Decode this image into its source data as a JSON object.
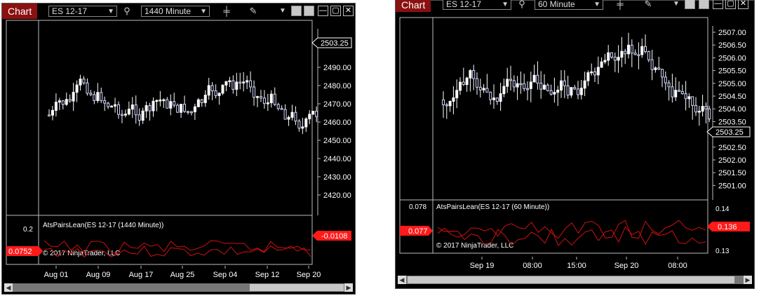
{
  "left": {
    "title": "Chart",
    "instrument": "ES 12-17",
    "interval": "1440 Minute",
    "price_labels": [
      "2490.00",
      "2480.00",
      "2470.00",
      "2460.00",
      "2450.00",
      "2440.00",
      "2430.00",
      "2420.00"
    ],
    "last_price": "2503.25",
    "indicator_label": "AtsPairsLean(ES 12-17 (1440 Minute))",
    "copyright": "© 2017 NinjaTrader, LLC",
    "ind_left_value": "0.2",
    "ind_left_marker": "0.0752",
    "ind_right_marker": "-0.0108",
    "dates": [
      "Aug 01",
      "Aug 09",
      "Aug 17",
      "Aug 25",
      "Sep 04",
      "Sep 12",
      "Sep 20"
    ]
  },
  "right": {
    "title": "Chart",
    "instrument": "ES 12-17",
    "interval": "60 Minute",
    "price_labels": [
      "2507.00",
      "2506.50",
      "2506.00",
      "2505.50",
      "2505.00",
      "2504.50",
      "2504.00",
      "2503.50",
      "2503.00",
      "2502.50",
      "2502.00",
      "2501.50",
      "2501.00"
    ],
    "last_price": "2503.25",
    "indicator_label": "AtsPairsLean(ES 12-17 (60 Minute))",
    "copyright": "© 2017 NinjaTrader, LLC",
    "ind_left_value": "0.078",
    "ind_left_marker": "0.077",
    "ind_right_labels": [
      "0.14",
      "0.13"
    ],
    "ind_right_marker": "0.136",
    "dates": [
      "Sep 19",
      "08:00",
      "15:00",
      "Sep 20",
      "08:00"
    ]
  },
  "colors": {
    "tag": "#8b1010",
    "up": "#ffffff",
    "down": "#d0d8ff",
    "line": "#d01010",
    "marker": "#ff1a1a"
  },
  "icons": [
    "dropdown-arrow-icon",
    "search-icon",
    "bar-type-icon",
    "pencil-icon",
    "minimize-icon",
    "maximize-icon",
    "close-icon"
  ]
}
